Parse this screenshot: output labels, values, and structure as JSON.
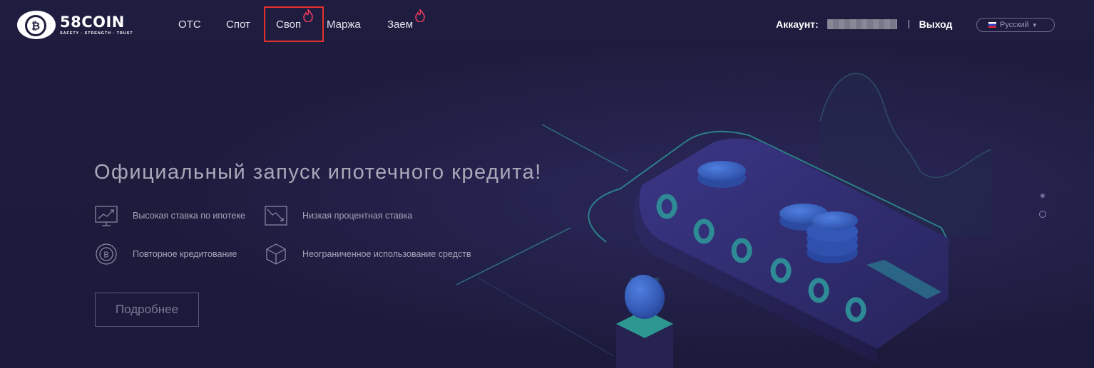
{
  "logo": {
    "name": "58COIN",
    "tagline": "SAFETY · STRENGTH · TRUST"
  },
  "nav": {
    "otc": "OTC",
    "spot": "Спот",
    "swap": "Своп",
    "margin": "Маржа",
    "loan": "Заем"
  },
  "account": {
    "label": "Аккаунт:",
    "logout": "Выход"
  },
  "language": {
    "selected": "Русский"
  },
  "hero": {
    "title": "Официальный запуск ипотечного кредита!",
    "features": [
      "Высокая ставка по ипотеке",
      "Низкая процентная ставка",
      "Повторное кредитование",
      "Неограниченное использование средств"
    ],
    "more_button": "Подробнее"
  },
  "colors": {
    "background": "#1e1c3d",
    "highlight": "#e3322e",
    "flame": "#e83a5c"
  }
}
